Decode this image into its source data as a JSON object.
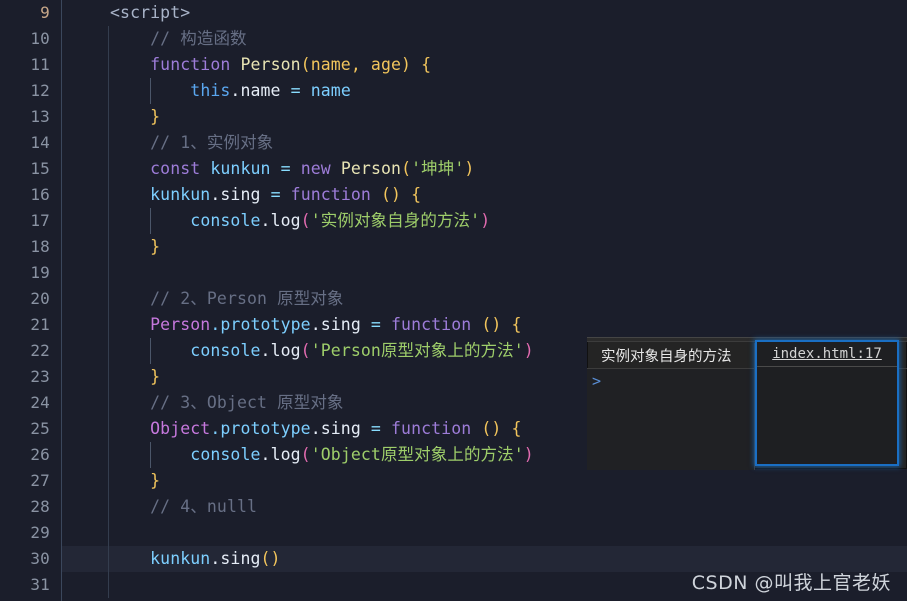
{
  "editor": {
    "first_line_number": 9,
    "active_line_number": 30,
    "lines": [
      {
        "num": "9",
        "text": "<script>"
      },
      {
        "num": "10",
        "text": "// 构造函数"
      },
      {
        "num": "11",
        "text": "function Person(name, age) {"
      },
      {
        "num": "12",
        "text": "this.name = name"
      },
      {
        "num": "13",
        "text": "}"
      },
      {
        "num": "14",
        "text": "// 1、实例对象"
      },
      {
        "num": "15",
        "text": "const kunkun = new Person('坤坤')"
      },
      {
        "num": "16",
        "text": "kunkun.sing = function () {"
      },
      {
        "num": "17",
        "text": "console.log('实例对象自身的方法')"
      },
      {
        "num": "18",
        "text": "}"
      },
      {
        "num": "19",
        "text": ""
      },
      {
        "num": "20",
        "text": "// 2、Person 原型对象"
      },
      {
        "num": "21",
        "text": "Person.prototype.sing = function () {"
      },
      {
        "num": "22",
        "text": "console.log('Person原型对象上的方法')"
      },
      {
        "num": "23",
        "text": "}"
      },
      {
        "num": "24",
        "text": "// 3、Object 原型对象"
      },
      {
        "num": "25",
        "text": "Object.prototype.sing = function () {"
      },
      {
        "num": "26",
        "text": "console.log('Object原型对象上的方法')"
      },
      {
        "num": "27",
        "text": "}"
      },
      {
        "num": "28",
        "text": "// 4、nulll"
      },
      {
        "num": "29",
        "text": ""
      },
      {
        "num": "30",
        "text": "kunkun.sing()"
      },
      {
        "num": "31",
        "text": ""
      }
    ],
    "tokens": {
      "script_tag": "<script>",
      "comment_constructor": "// 构造函数",
      "kw_function": "function",
      "name_person": "Person",
      "params_person": "(name, age)",
      "brace_open": "{",
      "brace_close": "}",
      "kw_this": "this",
      "prop_name": ".name",
      "op_assign": "=",
      "ident_name": "name",
      "comment_1": "// 1、实例对象",
      "kw_const": "const",
      "ident_kunkun": "kunkun",
      "kw_new": "new",
      "str_kunkun": "'坤坤'",
      "prop_sing": ".sing",
      "paren_empty": "()",
      "ident_console": "console",
      "prop_log": ".log",
      "str_instance_method": "'实例对象自身的方法'",
      "comment_2": "// 2、Person 原型对象",
      "obj_person": "Person",
      "prop_prototype": ".prototype",
      "str_person_proto": "'Person原型对象上的方法'",
      "comment_3": "// 3、Object 原型对象",
      "obj_object": "Object",
      "str_object_proto": "'Object原型对象上的方法'",
      "comment_4": "// 4、nulll",
      "call_kunkun_sing": "kunkun"
    },
    "colors": {
      "background": "#1b1e2b",
      "active_line": "#232736",
      "line_number": "#8a93a3",
      "keyword": "#9d7cd8",
      "function_name": "#e8e4b4",
      "identifier": "#7dcfff",
      "string": "#9ece6a",
      "comment": "#676f85",
      "bracket_yellow": "#f2c55c",
      "bracket_pink": "#e26bb0"
    }
  },
  "console": {
    "message": "实例对象自身的方法",
    "source_link": "index.html:17",
    "prompt_symbol": ">",
    "colors": {
      "panel_background": "#242424",
      "focus_ring": "#1a6fc4"
    }
  },
  "watermark": {
    "text": "CSDN @叫我上官老妖"
  }
}
